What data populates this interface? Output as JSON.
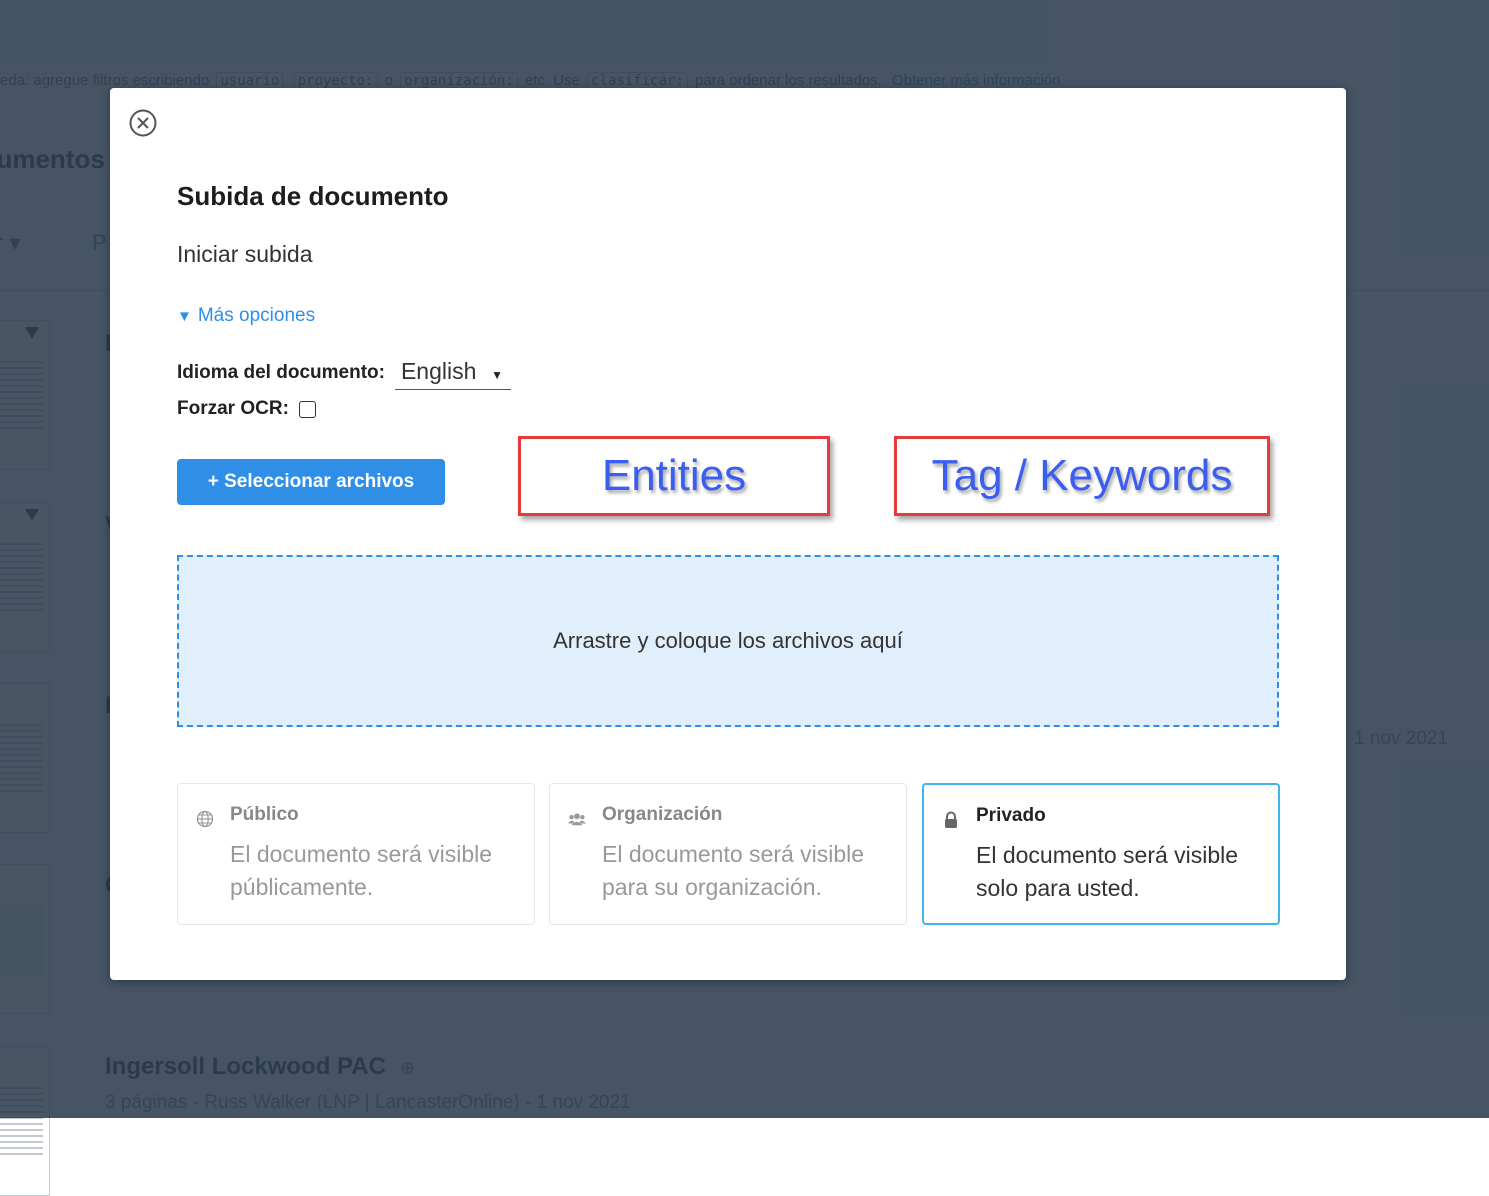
{
  "background": {
    "search_hint": {
      "prefix": "eda: agregue filtros escribiendo",
      "tokens": [
        "usuario",
        "proyecto:",
        "organización:",
        "clasificar:"
      ],
      "joiner_o": "o",
      "joiner_etc": "etc. Use",
      "suffix": "para ordenar los resultados.",
      "link": "Obtener más información"
    },
    "page_title": "cumentos",
    "filter_label": "r ▾",
    "filter_label_2": "P",
    "documents": [
      {
        "title": "I",
        "meta": ""
      },
      {
        "title": "V",
        "meta": ""
      },
      {
        "title": "I",
        "meta": "",
        "date": "1 nov 2021"
      },
      {
        "title": "C",
        "meta": ""
      },
      {
        "title": "Ingersoll Lockwood PAC",
        "meta": "3 páginas - Russ Walker (LNP | LancasterOnline) - 1 nov 2021"
      }
    ],
    "right_date": "1 nov 2021"
  },
  "modal": {
    "close_icon": "close-circle-icon",
    "title": "Subida de documento",
    "subtitle": "Iniciar subida",
    "more_options": {
      "icon": "▼",
      "label": "Más opciones"
    },
    "language": {
      "label": "Idioma del documento:",
      "value": "English"
    },
    "force_ocr": {
      "label": "Forzar OCR:",
      "checked": false
    },
    "select_files_label": "+ Seleccionar archivos",
    "annotations": {
      "entities": "Entities",
      "tags": "Tag / Keywords"
    },
    "dropzone_text": "Arrastre y coloque los archivos aquí",
    "visibility": [
      {
        "key": "public",
        "icon": "globe-icon",
        "name": "Público",
        "desc": "El documento será visible públicamente.",
        "selected": false
      },
      {
        "key": "organization",
        "icon": "group-icon",
        "name": "Organización",
        "desc": "El documento será visible para su organización.",
        "selected": false
      },
      {
        "key": "private",
        "icon": "lock-icon",
        "name": "Privado",
        "desc": "El documento será visible solo para usted.",
        "selected": true
      }
    ]
  },
  "colors": {
    "primary": "#2f8fe6",
    "selected_border": "#45b3ef",
    "annotation_border": "#e63b3b",
    "annotation_text": "#3a5ff0",
    "overlay": "#45576a"
  }
}
